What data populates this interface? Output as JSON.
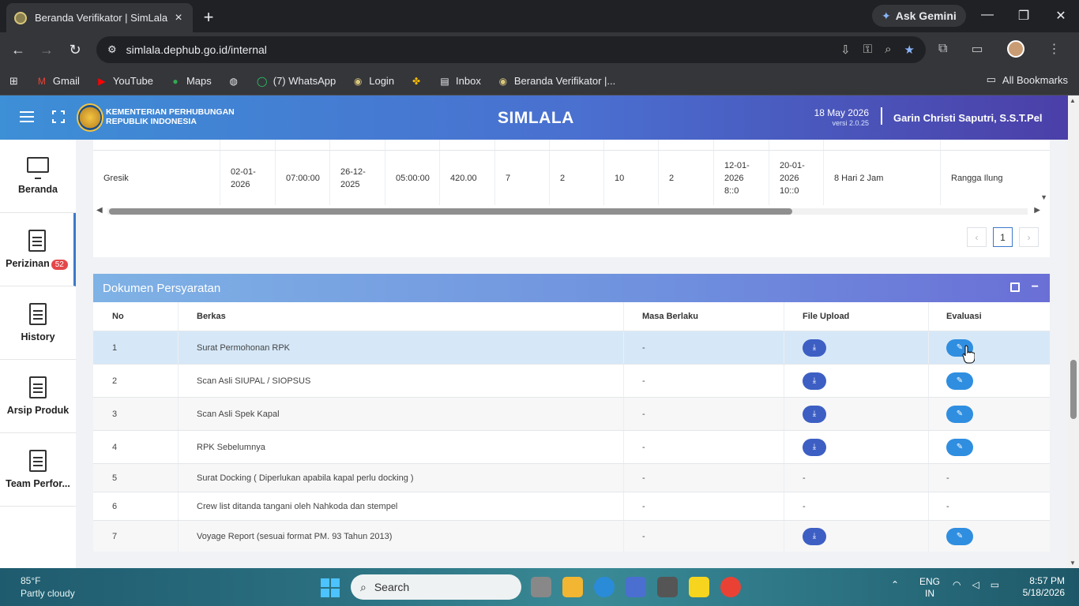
{
  "browser": {
    "tab_title": "Beranda Verifikator | SimLala",
    "new_tab": "+",
    "gemini_label": "Ask Gemini",
    "url": "simlala.dephub.go.id/internal",
    "bookmarks": [
      {
        "label": "Gmail",
        "icon": "gmail-icon"
      },
      {
        "label": "YouTube",
        "icon": "youtube-icon"
      },
      {
        "label": "Maps",
        "icon": "maps-icon"
      },
      {
        "label": "",
        "icon": "globe-icon"
      },
      {
        "label": "(7) WhatsApp",
        "icon": "whatsapp-icon"
      },
      {
        "label": "Login",
        "icon": "login-icon"
      },
      {
        "label": "",
        "icon": "pinwheel-icon"
      },
      {
        "label": "Inbox",
        "icon": "inbox-icon"
      },
      {
        "label": "Beranda Verifikator |...",
        "icon": "site-icon"
      }
    ],
    "all_bookmarks": "All Bookmarks"
  },
  "header": {
    "org_line1": "KEMENTERIAN PERHUBUNGAN",
    "org_line2": "REPUBLIK INDONESIA",
    "app_title": "SIMLALA",
    "date": "18 May 2026",
    "version": "versi 2.0.25",
    "user": "Garin Christi Saputri, S.S.T.Pel"
  },
  "sidebar": {
    "items": [
      {
        "label": "Beranda",
        "icon": "monitor-icon"
      },
      {
        "label": "Perizinan",
        "badge": "52",
        "icon": "document-icon"
      },
      {
        "label": "History",
        "icon": "document-icon"
      },
      {
        "label": "Arsip Produk",
        "icon": "document-icon"
      },
      {
        "label": "Team Perfor...",
        "icon": "document-icon"
      }
    ]
  },
  "top_table": {
    "row": [
      "Gresik",
      "02-01-\n2026",
      "07:00:00",
      "26-12-\n2025",
      "05:00:00",
      "420.00",
      "7",
      "2",
      "10",
      "2",
      "12-01-\n2026\n8::0",
      "20-01-\n2026\n10::0",
      "8 Hari 2 Jam",
      "Rangga Ilung"
    ]
  },
  "pagination": {
    "prev": "‹",
    "current": "1",
    "next": "›"
  },
  "documents": {
    "title": "Dokumen Persyaratan",
    "headers": {
      "no": "No",
      "berkas": "Berkas",
      "masa": "Masa Berlaku",
      "file": "File Upload",
      "eval": "Evaluasi"
    },
    "rows": [
      {
        "no": "1",
        "berkas": "Surat Permohonan RPK",
        "masa": "-",
        "file": "download",
        "eval": "edit"
      },
      {
        "no": "2",
        "berkas": "Scan Asli SIUPAL / SIOPSUS",
        "masa": "-",
        "file": "download",
        "eval": "edit"
      },
      {
        "no": "3",
        "berkas": "Scan Asli Spek Kapal",
        "masa": "-",
        "file": "download",
        "eval": "edit"
      },
      {
        "no": "4",
        "berkas": "RPK Sebelumnya",
        "masa": "-",
        "file": "download",
        "eval": "edit"
      },
      {
        "no": "5",
        "berkas": "Surat Docking ( Diperlukan apabila kapal perlu docking )",
        "masa": "-",
        "file": "-",
        "eval": "-"
      },
      {
        "no": "6",
        "berkas": "Crew list ditanda tangani oleh Nahkoda dan stempel",
        "masa": "-",
        "file": "-",
        "eval": "-"
      },
      {
        "no": "7",
        "berkas": "Voyage Report (sesuai format PM. 93 Tahun 2013)",
        "masa": "-",
        "file": "download",
        "eval": "edit"
      }
    ]
  },
  "taskbar": {
    "weather_temp": "85°F",
    "weather_desc": "Partly cloudy",
    "search_label": "Search",
    "lang1": "ENG",
    "lang2": "IN",
    "time": "8:57 PM",
    "date": "5/18/2026"
  }
}
